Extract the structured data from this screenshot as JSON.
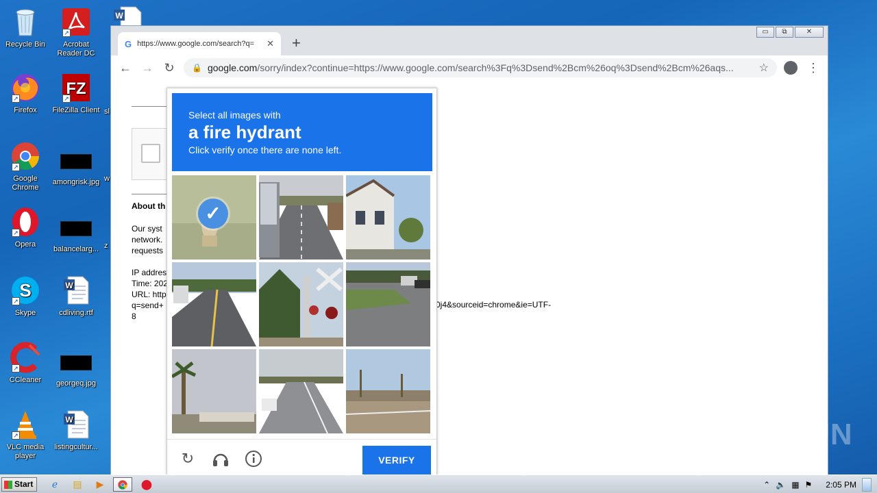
{
  "desktop": {
    "icons": [
      {
        "label": "Recycle Bin"
      },
      {
        "label": "Acrobat Reader DC"
      },
      {
        "label": "Firefox"
      },
      {
        "label": "FileZilla Client"
      },
      {
        "label": "Google Chrome"
      },
      {
        "label": "amongrisk.jpg"
      },
      {
        "label": "Opera"
      },
      {
        "label": "balancelarg..."
      },
      {
        "label": "Skype"
      },
      {
        "label": "cdliving.rtf"
      },
      {
        "label": "CCleaner"
      },
      {
        "label": "georgeq.jpg"
      },
      {
        "label": "VLC media player"
      },
      {
        "label": "listingcultur..."
      }
    ],
    "partial_labels": [
      "sl",
      "w",
      "z"
    ]
  },
  "browser": {
    "tab_title": "https://www.google.com/search?q=",
    "tab_close": "✕",
    "new_tab": "+",
    "address_domain": "google.com",
    "address_path": "/sorry/index?continue=https://www.google.com/search%3Fq%3Dsend%2Bcm%26oq%3Dsend%2Bcm%26aqs...",
    "window_controls": {
      "minimize": "▭",
      "maximize": "⧉",
      "close": "✕"
    }
  },
  "page": {
    "about_heading": "About th",
    "para_lines": [
      "Our syst",
      "network.",
      "requests"
    ],
    "info_lines": [
      "IP addres",
      "Time: 202",
      "URL: http",
      "q=send+",
      "8"
    ],
    "url_tail": "0j4&sourceid=chrome&ie=UTF-"
  },
  "captcha": {
    "line1": "Select all images with",
    "line2": "a fire hydrant",
    "line3": "Click verify once there are none left.",
    "verify_label": "VERIFY",
    "header_color": "#1a73e8",
    "tiles": [
      {
        "selected": true
      },
      {
        "selected": false
      },
      {
        "selected": false
      },
      {
        "selected": false
      },
      {
        "selected": false
      },
      {
        "selected": false
      },
      {
        "selected": false
      },
      {
        "selected": false
      },
      {
        "selected": false
      }
    ]
  },
  "taskbar": {
    "start_label": "Start",
    "clock": "2:05 PM"
  },
  "watermark": "ANY RUN"
}
